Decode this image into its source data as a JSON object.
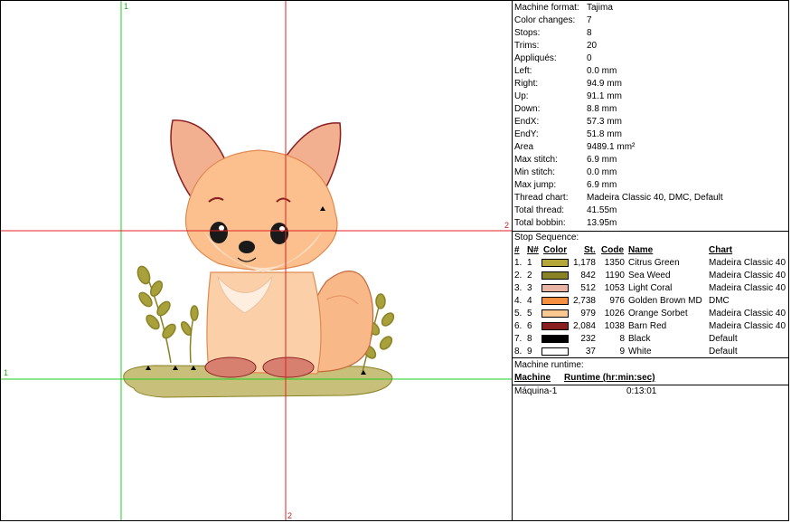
{
  "guides": {
    "top_green": "1",
    "left_green": "1",
    "right_red": "2",
    "bottom_red": "2"
  },
  "stats": [
    {
      "k": "Machine format:",
      "v": "Tajima"
    },
    {
      "k": "Color changes:",
      "v": "7"
    },
    {
      "k": "Stops:",
      "v": "8"
    },
    {
      "k": "Trims:",
      "v": "20"
    },
    {
      "k": "Appliqués:",
      "v": "0"
    },
    {
      "k": "Left:",
      "v": "0.0 mm"
    },
    {
      "k": "Right:",
      "v": "94.9 mm"
    },
    {
      "k": "Up:",
      "v": "91.1 mm"
    },
    {
      "k": "Down:",
      "v": "8.8 mm"
    },
    {
      "k": "EndX:",
      "v": "57.3 mm"
    },
    {
      "k": "EndY:",
      "v": "51.8 mm"
    },
    {
      "k": "Area",
      "v": "9489.1 mm²"
    },
    {
      "k": "Max stitch:",
      "v": "6.9 mm"
    },
    {
      "k": "Min stitch:",
      "v": "0.0 mm"
    },
    {
      "k": "Max jump:",
      "v": "6.9 mm"
    },
    {
      "k": "Thread chart:",
      "v": "Madeira Classic 40, DMC, Default"
    },
    {
      "k": "Total thread:",
      "v": "41.55m"
    },
    {
      "k": "Total bobbin:",
      "v": "13.95m"
    }
  ],
  "stop_sequence": {
    "title": "Stop Sequence:",
    "headers": {
      "num": "#",
      "n": "N#",
      "color": "Color",
      "st": "St.",
      "code": "Code",
      "name": "Name",
      "chart": "Chart"
    },
    "rows": [
      {
        "num": "1.",
        "n": "1",
        "hex": "#b5a63a",
        "st": "1,178",
        "code": "1350",
        "name": "Citrus Green",
        "chart": "Madeira Classic 40"
      },
      {
        "num": "2.",
        "n": "2",
        "hex": "#8a8226",
        "st": "842",
        "code": "1190",
        "name": "Sea Weed",
        "chart": "Madeira Classic 40"
      },
      {
        "num": "3.",
        "n": "3",
        "hex": "#eab4a4",
        "st": "512",
        "code": "1053",
        "name": "Light Coral",
        "chart": "Madeira Classic 40"
      },
      {
        "num": "4.",
        "n": "4",
        "hex": "#f59040",
        "st": "2,738",
        "code": "976",
        "name": "Golden Brown MD",
        "chart": "DMC"
      },
      {
        "num": "5.",
        "n": "5",
        "hex": "#fbc891",
        "st": "979",
        "code": "1026",
        "name": "Orange Sorbet",
        "chart": "Madeira Classic 40"
      },
      {
        "num": "6.",
        "n": "6",
        "hex": "#8a1f1f",
        "st": "2,084",
        "code": "1038",
        "name": "Barn Red",
        "chart": "Madeira Classic 40"
      },
      {
        "num": "7.",
        "n": "8",
        "hex": "#000000",
        "st": "232",
        "code": "8",
        "name": "Black",
        "chart": "Default"
      },
      {
        "num": "8.",
        "n": "9",
        "hex": "#ffffff",
        "st": "37",
        "code": "9",
        "name": "White",
        "chart": "Default"
      }
    ]
  },
  "runtime": {
    "title": "Machine runtime:",
    "headers": {
      "machine": "Machine",
      "runtime": "Runtime (hr:min:sec)"
    },
    "rows": [
      {
        "machine": "Máquina-1",
        "runtime": "0:13:01"
      }
    ]
  }
}
